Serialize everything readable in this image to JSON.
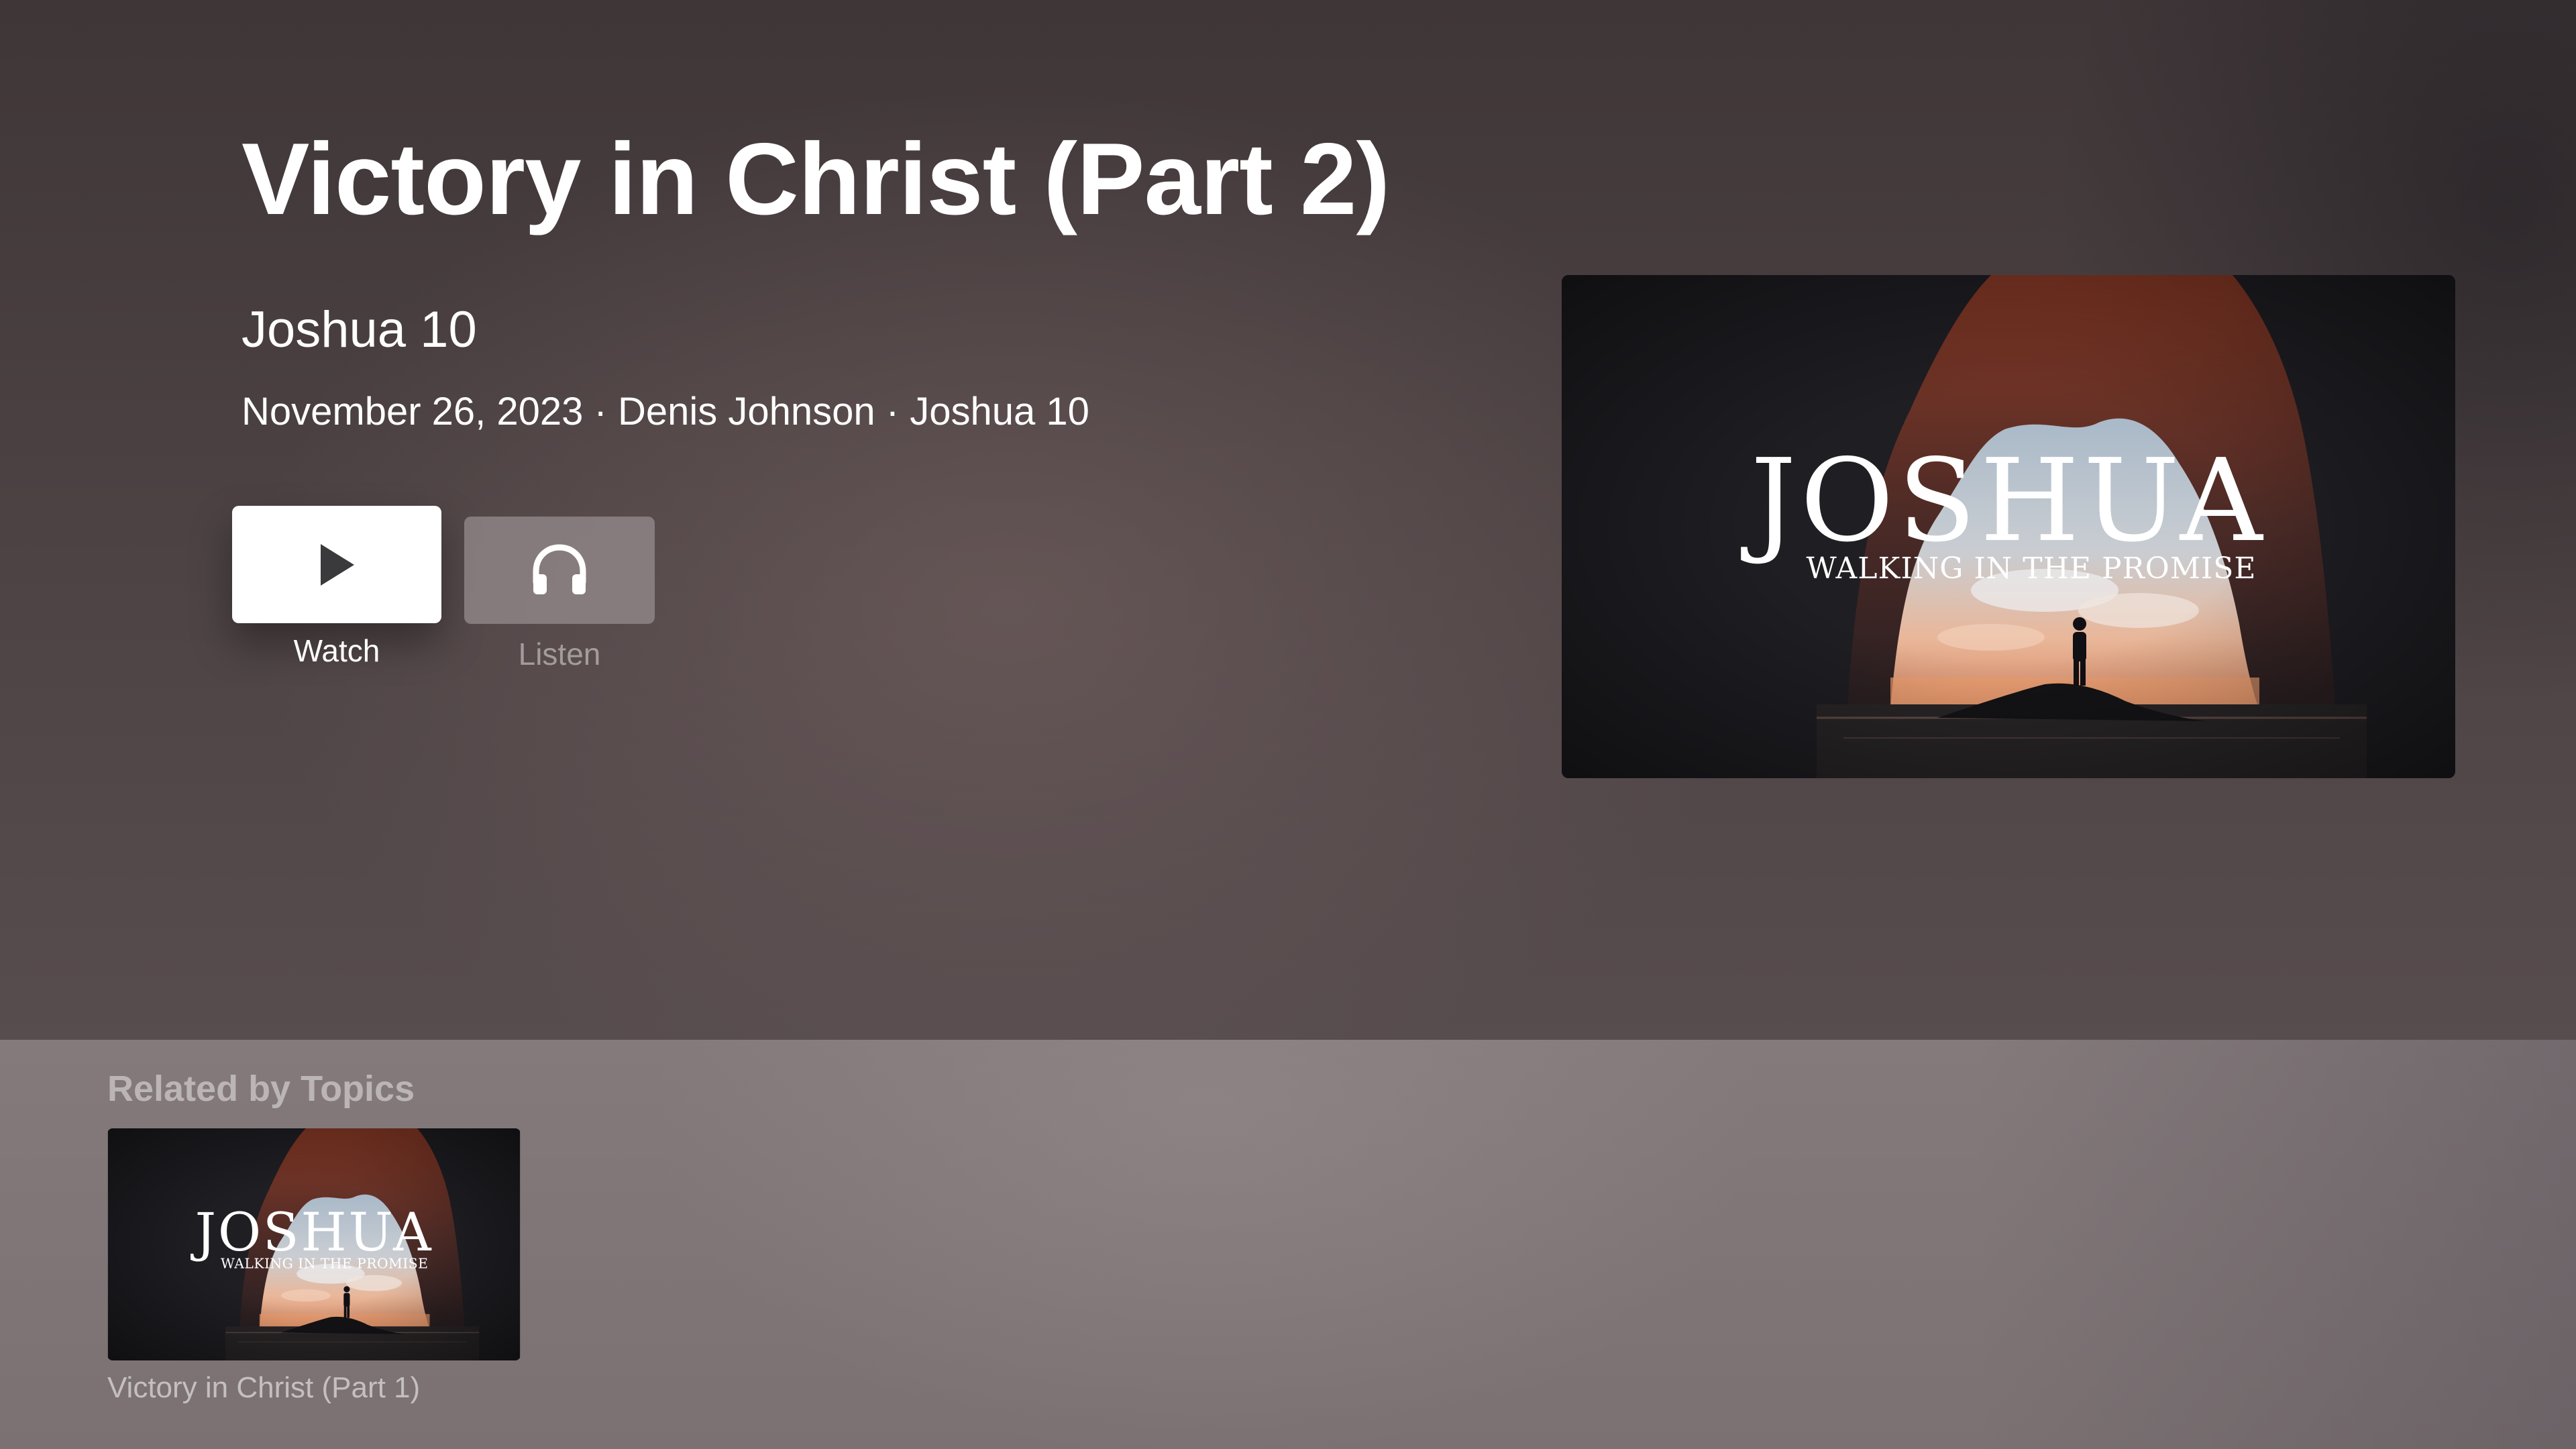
{
  "episode": {
    "title": "Victory in Christ (Part 2)",
    "subtitle": "Joshua 10",
    "meta": "November 26, 2023 · Denis Johnson · Joshua 10"
  },
  "actions": [
    {
      "label": "Watch",
      "icon": "play-icon",
      "focused": true
    },
    {
      "label": "Listen",
      "icon": "headphones-icon",
      "focused": false
    }
  ],
  "artwork": {
    "series_title": "JOSHUA",
    "series_tagline": "WALKING IN THE PROMISE"
  },
  "related": {
    "heading": "Related by Topics",
    "items": [
      {
        "title": "Victory in Christ (Part 1)",
        "series_title": "JOSHUA",
        "series_tagline": "WALKING IN THE PROMISE"
      }
    ]
  },
  "colors": {
    "hero_background": "#4b4142",
    "shelf_background": "#847a7c",
    "focused_button": "#ffffff",
    "unfocused_button": "#968c8e"
  }
}
